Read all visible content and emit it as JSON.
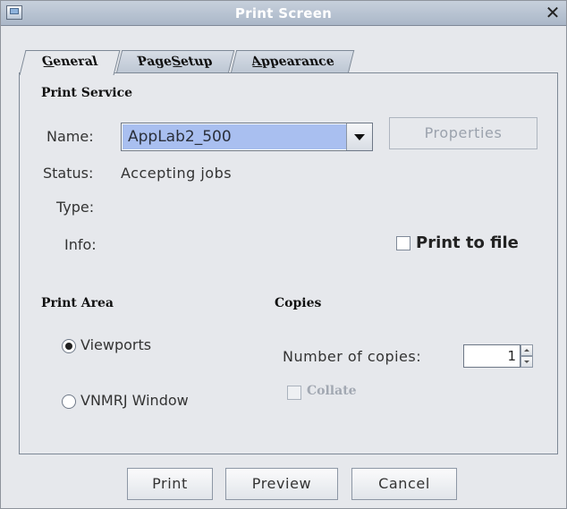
{
  "window": {
    "title": "Print Screen",
    "close_glyph": "✕"
  },
  "tabs": [
    {
      "pre": "",
      "u": "G",
      "post": "eneral"
    },
    {
      "pre": "Page ",
      "u": "S",
      "post": "etup"
    },
    {
      "pre": "",
      "u": "A",
      "post": "ppearance"
    }
  ],
  "print_service": {
    "heading": "Print Service",
    "name_label": "Name:",
    "name_value": "AppLab2_500",
    "properties_label": "Properties",
    "status_label": "Status:",
    "status_value": "Accepting jobs",
    "type_label": "Type:",
    "info_label": "Info:",
    "print_to_file_label": "Print to file"
  },
  "print_area": {
    "heading": "Print Area",
    "options": [
      "Viewports",
      "VNMRJ Window"
    ],
    "selected": "Viewports"
  },
  "copies": {
    "heading": "Copies",
    "number_label": "Number of copies:",
    "number_value": "1",
    "collate_label": "Collate"
  },
  "buttons": {
    "print": "Print",
    "preview": "Preview",
    "cancel": "Cancel"
  },
  "icons": {
    "window": "window-icon",
    "close": "close-icon",
    "dropdown": "chevron-down-icon"
  }
}
